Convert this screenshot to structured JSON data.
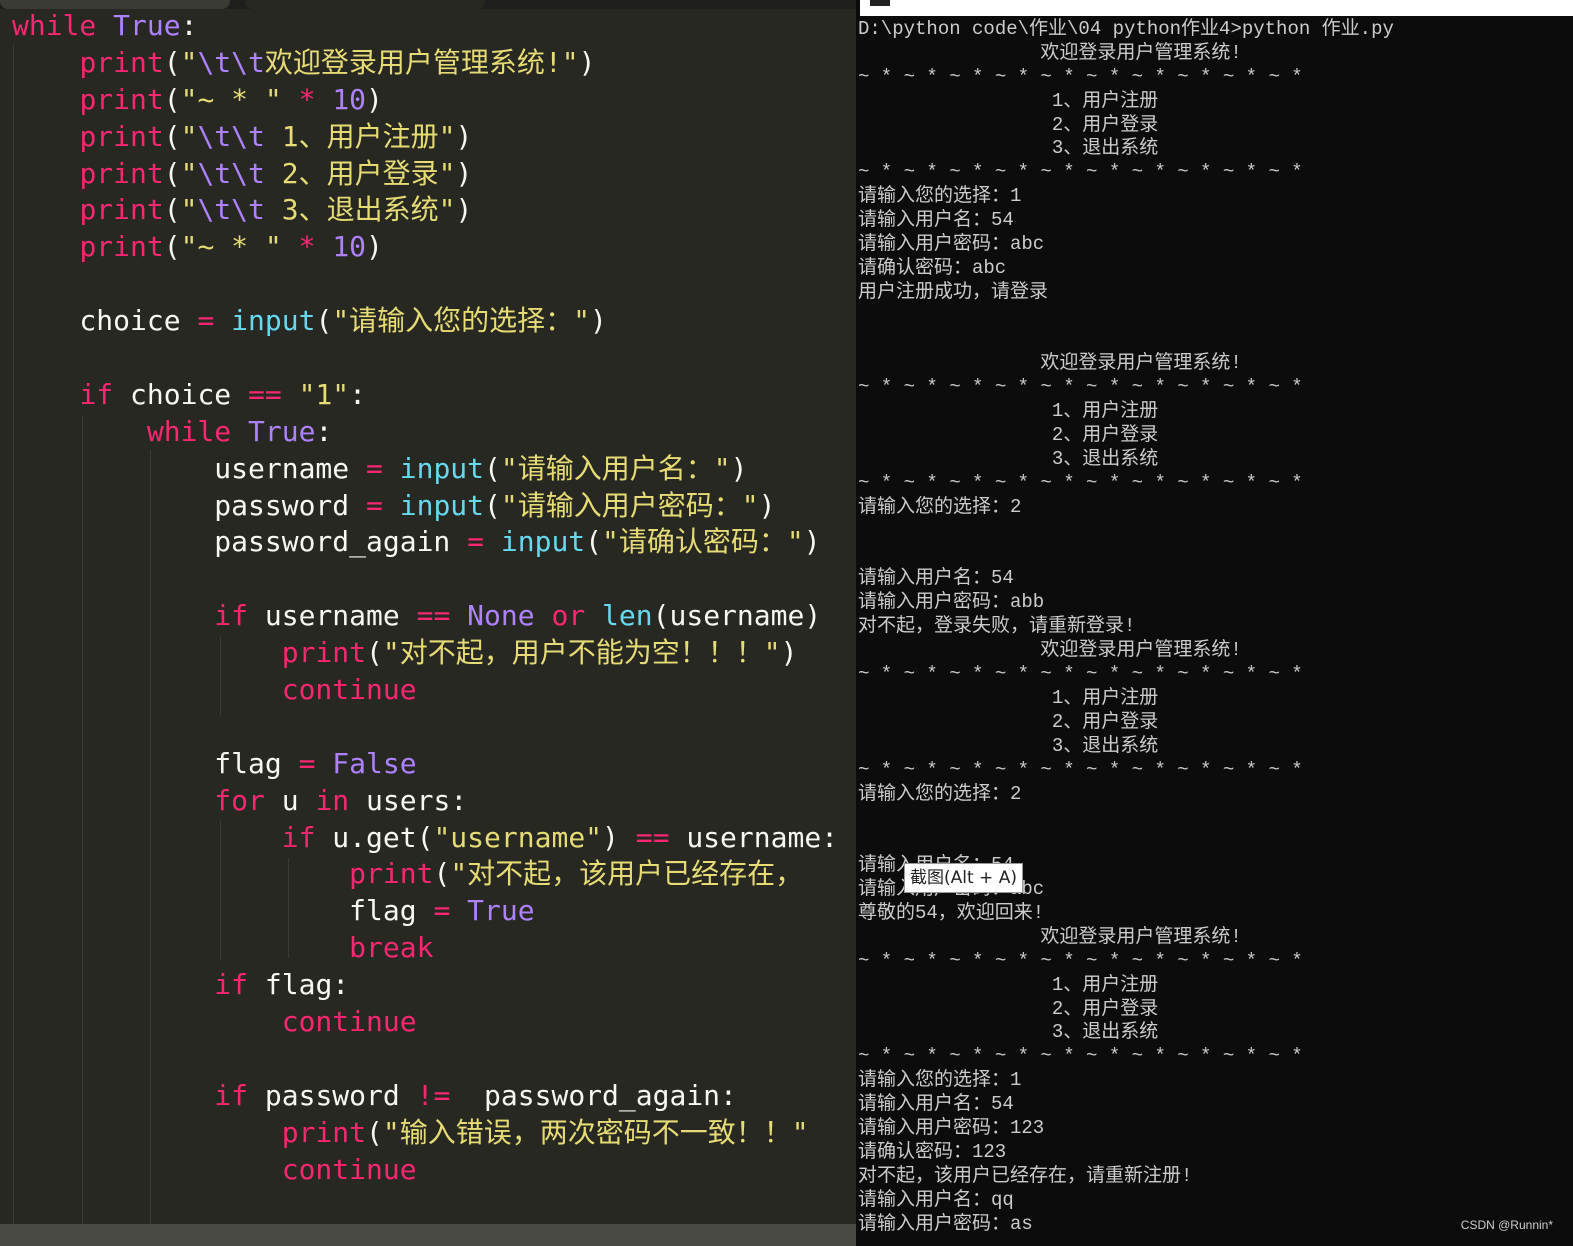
{
  "colors": {
    "editor_bg": "#272822",
    "terminal_bg": "#0c0c0c",
    "keyword": "#f92672",
    "constant": "#ae81ff",
    "string": "#e6db74",
    "function": "#66d9ef",
    "text": "#f8f8f2"
  },
  "editor": {
    "lines": [
      [
        [
          "k",
          "while"
        ],
        [
          "p",
          " "
        ],
        [
          "c",
          "True"
        ],
        [
          "p",
          ":"
        ]
      ],
      [
        [
          "p",
          "    "
        ],
        [
          "k",
          "print"
        ],
        [
          "p",
          "("
        ],
        [
          "s",
          "\""
        ],
        [
          "c",
          "\\t\\t"
        ],
        [
          "s",
          "欢迎登录用户管理系统!\""
        ],
        [
          "p",
          ")"
        ]
      ],
      [
        [
          "p",
          "    "
        ],
        [
          "k",
          "print"
        ],
        [
          "p",
          "("
        ],
        [
          "s",
          "\"~ * \""
        ],
        [
          "p",
          " "
        ],
        [
          "o",
          "*"
        ],
        [
          "p",
          " "
        ],
        [
          "c",
          "10"
        ],
        [
          "p",
          ")"
        ]
      ],
      [
        [
          "p",
          "    "
        ],
        [
          "k",
          "print"
        ],
        [
          "p",
          "("
        ],
        [
          "s",
          "\""
        ],
        [
          "c",
          "\\t\\t"
        ],
        [
          "s",
          " 1、用户注册\""
        ],
        [
          "p",
          ")"
        ]
      ],
      [
        [
          "p",
          "    "
        ],
        [
          "k",
          "print"
        ],
        [
          "p",
          "("
        ],
        [
          "s",
          "\""
        ],
        [
          "c",
          "\\t\\t"
        ],
        [
          "s",
          " 2、用户登录\""
        ],
        [
          "p",
          ")"
        ]
      ],
      [
        [
          "p",
          "    "
        ],
        [
          "k",
          "print"
        ],
        [
          "p",
          "("
        ],
        [
          "s",
          "\""
        ],
        [
          "c",
          "\\t\\t"
        ],
        [
          "s",
          " 3、退出系统\""
        ],
        [
          "p",
          ")"
        ]
      ],
      [
        [
          "p",
          "    "
        ],
        [
          "k",
          "print"
        ],
        [
          "p",
          "("
        ],
        [
          "s",
          "\"~ * \""
        ],
        [
          "p",
          " "
        ],
        [
          "o",
          "*"
        ],
        [
          "p",
          " "
        ],
        [
          "c",
          "10"
        ],
        [
          "p",
          ")"
        ]
      ],
      [],
      [
        [
          "p",
          "    choice "
        ],
        [
          "o",
          "="
        ],
        [
          "p",
          " "
        ],
        [
          "f",
          "input"
        ],
        [
          "p",
          "("
        ],
        [
          "s",
          "\"请输入您的选择：\""
        ],
        [
          "p",
          ")"
        ]
      ],
      [],
      [
        [
          "p",
          "    "
        ],
        [
          "k",
          "if"
        ],
        [
          "p",
          " choice "
        ],
        [
          "o",
          "=="
        ],
        [
          "p",
          " "
        ],
        [
          "s",
          "\"1\""
        ],
        [
          "p",
          ":"
        ]
      ],
      [
        [
          "p",
          "        "
        ],
        [
          "k",
          "while"
        ],
        [
          "p",
          " "
        ],
        [
          "c",
          "True"
        ],
        [
          "p",
          ":"
        ]
      ],
      [
        [
          "p",
          "            username "
        ],
        [
          "o",
          "="
        ],
        [
          "p",
          " "
        ],
        [
          "f",
          "input"
        ],
        [
          "p",
          "("
        ],
        [
          "s",
          "\"请输入用户名：\""
        ],
        [
          "p",
          ")"
        ]
      ],
      [
        [
          "p",
          "            password "
        ],
        [
          "o",
          "="
        ],
        [
          "p",
          " "
        ],
        [
          "f",
          "input"
        ],
        [
          "p",
          "("
        ],
        [
          "s",
          "\"请输入用户密码：\""
        ],
        [
          "p",
          ")"
        ]
      ],
      [
        [
          "p",
          "            password_again "
        ],
        [
          "o",
          "="
        ],
        [
          "p",
          " "
        ],
        [
          "f",
          "input"
        ],
        [
          "p",
          "("
        ],
        [
          "s",
          "\"请确认密码：\""
        ],
        [
          "p",
          ")"
        ]
      ],
      [],
      [
        [
          "p",
          "            "
        ],
        [
          "k",
          "if"
        ],
        [
          "p",
          " username "
        ],
        [
          "o",
          "=="
        ],
        [
          "p",
          " "
        ],
        [
          "c",
          "None"
        ],
        [
          "p",
          " "
        ],
        [
          "k",
          "or"
        ],
        [
          "p",
          " "
        ],
        [
          "f",
          "len"
        ],
        [
          "p",
          "(username)"
        ]
      ],
      [
        [
          "p",
          "                "
        ],
        [
          "k",
          "print"
        ],
        [
          "p",
          "("
        ],
        [
          "s",
          "\"对不起，用户不能为空！！！\""
        ],
        [
          "p",
          ")"
        ]
      ],
      [
        [
          "p",
          "                "
        ],
        [
          "k",
          "continue"
        ]
      ],
      [],
      [
        [
          "p",
          "            flag "
        ],
        [
          "o",
          "="
        ],
        [
          "p",
          " "
        ],
        [
          "c",
          "False"
        ]
      ],
      [
        [
          "p",
          "            "
        ],
        [
          "k",
          "for"
        ],
        [
          "p",
          " u "
        ],
        [
          "k",
          "in"
        ],
        [
          "p",
          " users:"
        ]
      ],
      [
        [
          "p",
          "                "
        ],
        [
          "k",
          "if"
        ],
        [
          "p",
          " u.get("
        ],
        [
          "s",
          "\"username\""
        ],
        [
          "p",
          ") "
        ],
        [
          "o",
          "=="
        ],
        [
          "p",
          " username:"
        ]
      ],
      [
        [
          "p",
          "                    "
        ],
        [
          "k",
          "print"
        ],
        [
          "p",
          "("
        ],
        [
          "s",
          "\"对不起，该用户已经存在，"
        ]
      ],
      [
        [
          "p",
          "                    flag "
        ],
        [
          "o",
          "="
        ],
        [
          "p",
          " "
        ],
        [
          "c",
          "True"
        ]
      ],
      [
        [
          "p",
          "                    "
        ],
        [
          "k",
          "break"
        ]
      ],
      [
        [
          "p",
          "            "
        ],
        [
          "k",
          "if"
        ],
        [
          "p",
          " flag:"
        ]
      ],
      [
        [
          "p",
          "                "
        ],
        [
          "k",
          "continue"
        ]
      ],
      [],
      [
        [
          "p",
          "            "
        ],
        [
          "k",
          "if"
        ],
        [
          "p",
          " password "
        ],
        [
          "o",
          "!="
        ],
        [
          "p",
          "  password_again:"
        ]
      ],
      [
        [
          "p",
          "                "
        ],
        [
          "k",
          "print"
        ],
        [
          "p",
          "("
        ],
        [
          "s",
          "\"输入错误，两次密码不一致！！\""
        ]
      ],
      [
        [
          "p",
          "                "
        ],
        [
          "k",
          "continue"
        ]
      ]
    ]
  },
  "terminal": {
    "lines": [
      "D:\\python code\\作业\\04 python作业4>python 作业.py",
      "                欢迎登录用户管理系统!",
      "~ * ~ * ~ * ~ * ~ * ~ * ~ * ~ * ~ * ~ * ",
      "                 1、用户注册",
      "                 2、用户登录",
      "                 3、退出系统",
      "~ * ~ * ~ * ~ * ~ * ~ * ~ * ~ * ~ * ~ * ",
      "请输入您的选择：1",
      "请输入用户名：54",
      "请输入用户密码：abc",
      "请确认密码：abc",
      "用户注册成功，请登录",
      "",
      "",
      "                欢迎登录用户管理系统!",
      "~ * ~ * ~ * ~ * ~ * ~ * ~ * ~ * ~ * ~ * ",
      "                 1、用户注册",
      "                 2、用户登录",
      "                 3、退出系统",
      "~ * ~ * ~ * ~ * ~ * ~ * ~ * ~ * ~ * ~ * ",
      "请输入您的选择：2",
      "",
      "",
      "请输入用户名：54",
      "请输入用户密码：abb",
      "对不起，登录失败，请重新登录!",
      "                欢迎登录用户管理系统!",
      "~ * ~ * ~ * ~ * ~ * ~ * ~ * ~ * ~ * ~ * ",
      "                 1、用户注册",
      "                 2、用户登录",
      "                 3、退出系统",
      "~ * ~ * ~ * ~ * ~ * ~ * ~ * ~ * ~ * ~ * ",
      "请输入您的选择：2",
      "",
      "",
      "请输入用户名：54",
      "请输入用户密码：abc",
      "尊敬的54，欢迎回来!",
      "                欢迎登录用户管理系统!",
      "~ * ~ * ~ * ~ * ~ * ~ * ~ * ~ * ~ * ~ * ",
      "                 1、用户注册",
      "                 2、用户登录",
      "                 3、退出系统",
      "~ * ~ * ~ * ~ * ~ * ~ * ~ * ~ * ~ * ~ * ",
      "请输入您的选择：1",
      "请输入用户名：54",
      "请输入用户密码：123",
      "请确认密码：123",
      "对不起，该用户已经存在，请重新注册!",
      "请输入用户名：qq",
      "请输入用户密码：as"
    ],
    "tooltip": "截图(Alt + A)"
  },
  "watermark": "CSDN @Runnin*"
}
